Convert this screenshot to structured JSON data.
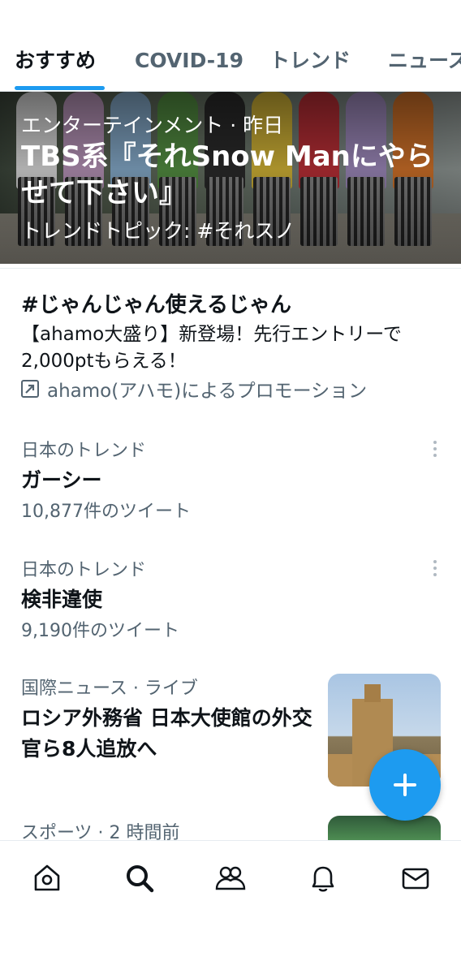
{
  "tabs": [
    {
      "label": "おすすめ",
      "active": true
    },
    {
      "label": "COVID-19",
      "active": false
    },
    {
      "label": "トレンド",
      "active": false
    },
    {
      "label": "ニュース",
      "active": false
    }
  ],
  "hero": {
    "category": "エンターテインメント · 昨日",
    "title": "TBS系『それSnow Manにやらせて下さい』",
    "topic": "トレンドトピック: #それスノ"
  },
  "promo": {
    "hashtag": "#じゃんじゃん使えるじゃん",
    "description": "【ahamo大盛り】新登場！先行エントリーで2,000ptもらえる！",
    "promoted_by": "ahamo(アハモ)によるプロモーション"
  },
  "trends": [
    {
      "category": "日本のトレンド",
      "name": "ガーシー",
      "count": "10,877件のツイート"
    },
    {
      "category": "日本のトレンド",
      "name": "検非違使",
      "count": "9,190件のツイート"
    }
  ],
  "news": {
    "category": "国際ニュース · ライブ",
    "title": "ロシア外務省 日本大使館の外交官ら8人追放へ"
  },
  "sports": {
    "category": "スポーツ · 2 時間前"
  },
  "bottom_nav": [
    "home-icon",
    "search-icon",
    "communities-icon",
    "notifications-icon",
    "messages-icon"
  ],
  "colors": {
    "accent": "#1d9bf0",
    "text": "#0f1419",
    "secondary": "#536471"
  }
}
